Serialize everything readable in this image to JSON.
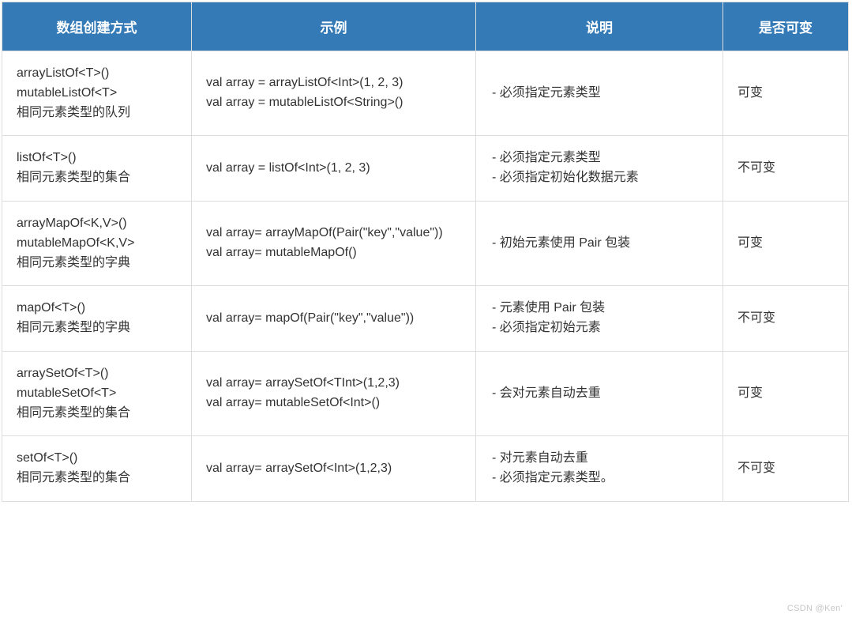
{
  "headers": [
    "数组创建方式",
    "示例",
    "说明",
    "是否可变"
  ],
  "rows": [
    {
      "method": "arrayListOf<T>()\nmutableListOf<T>\n相同元素类型的队列",
      "example": "val array = arrayListOf<Int>(1, 2, 3)\nval array = mutableListOf<String>()",
      "desc": [
        "必须指定元素类型"
      ],
      "mutable": "可变"
    },
    {
      "method": "listOf<T>()\n相同元素类型的集合",
      "example": "val array = listOf<Int>(1, 2, 3)",
      "desc": [
        "必须指定元素类型",
        "必须指定初始化数据元素"
      ],
      "mutable": "不可变"
    },
    {
      "method": "arrayMapOf<K,V>()\nmutableMapOf<K,V>\n相同元素类型的字典",
      "example": "val array= arrayMapOf(Pair(\"key\",\"value\"))\nval array= mutableMapOf()",
      "desc": [
        "初始元素使用 Pair 包装"
      ],
      "mutable": "可变"
    },
    {
      "method": "mapOf<T>()\n相同元素类型的字典",
      "example": "val array= mapOf(Pair(\"key\",\"value\"))",
      "desc": [
        "元素使用 Pair 包装",
        "必须指定初始元素"
      ],
      "mutable": "不可变"
    },
    {
      "method": "arraySetOf<T>()\nmutableSetOf<T>\n相同元素类型的集合",
      "example": "val array= arraySetOf<TInt>(1,2,3)\nval array= mutableSetOf<Int>()",
      "desc": [
        "会对元素自动去重"
      ],
      "mutable": "可变"
    },
    {
      "method": "setOf<T>()\n相同元素类型的集合",
      "example": "val array= arraySetOf<Int>(1,2,3)",
      "desc": [
        "对元素自动去重",
        "必须指定元素类型。"
      ],
      "mutable": "不可变"
    }
  ],
  "watermark": "CSDN @Ken'"
}
